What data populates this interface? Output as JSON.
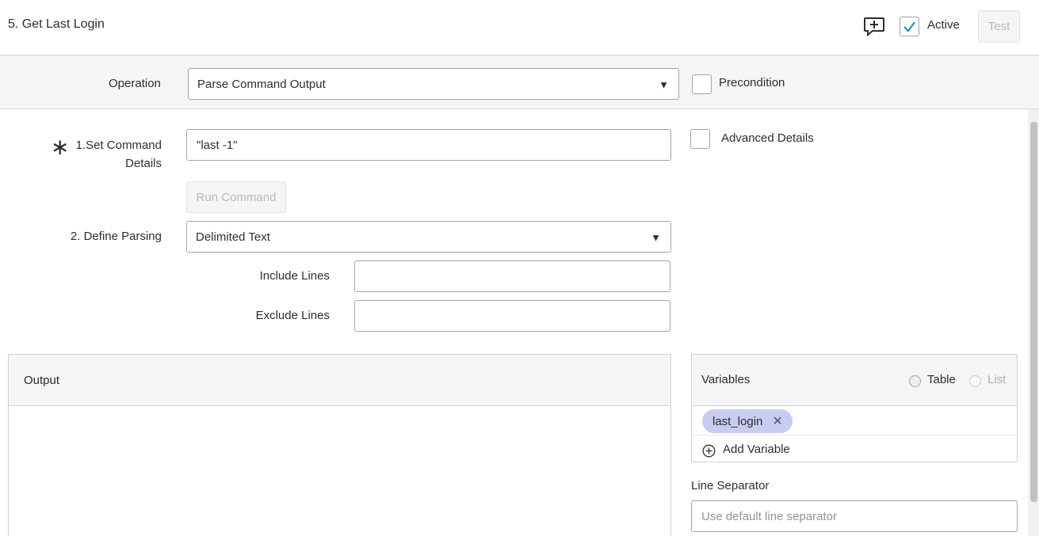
{
  "header": {
    "title": "5. Get Last Login",
    "active_label": "Active",
    "active_checked": true,
    "test_label": "Test"
  },
  "operation": {
    "label": "Operation",
    "selected": "Parse Command Output",
    "precondition_label": "Precondition"
  },
  "command": {
    "label_line1": "1.Set Command",
    "label_line2": "Details",
    "value": "\"last -1\"",
    "advanced_label": "Advanced Details",
    "run_label": "Run Command"
  },
  "parsing": {
    "label": "2. Define Parsing",
    "selected": "Delimited Text",
    "include_label": "Include Lines",
    "include_value": "",
    "exclude_label": "Exclude Lines",
    "exclude_value": ""
  },
  "output": {
    "title": "Output"
  },
  "variables": {
    "title": "Variables",
    "option_table": "Table",
    "option_list": "List",
    "chips": [
      "last_login"
    ],
    "add_label": "Add Variable"
  },
  "line_separator": {
    "label": "Line Separator",
    "placeholder": "Use default line separator"
  },
  "colors": {
    "accent": "#1f8ce6",
    "chip": "#c9cbf0",
    "band": "#f4f5f6"
  }
}
